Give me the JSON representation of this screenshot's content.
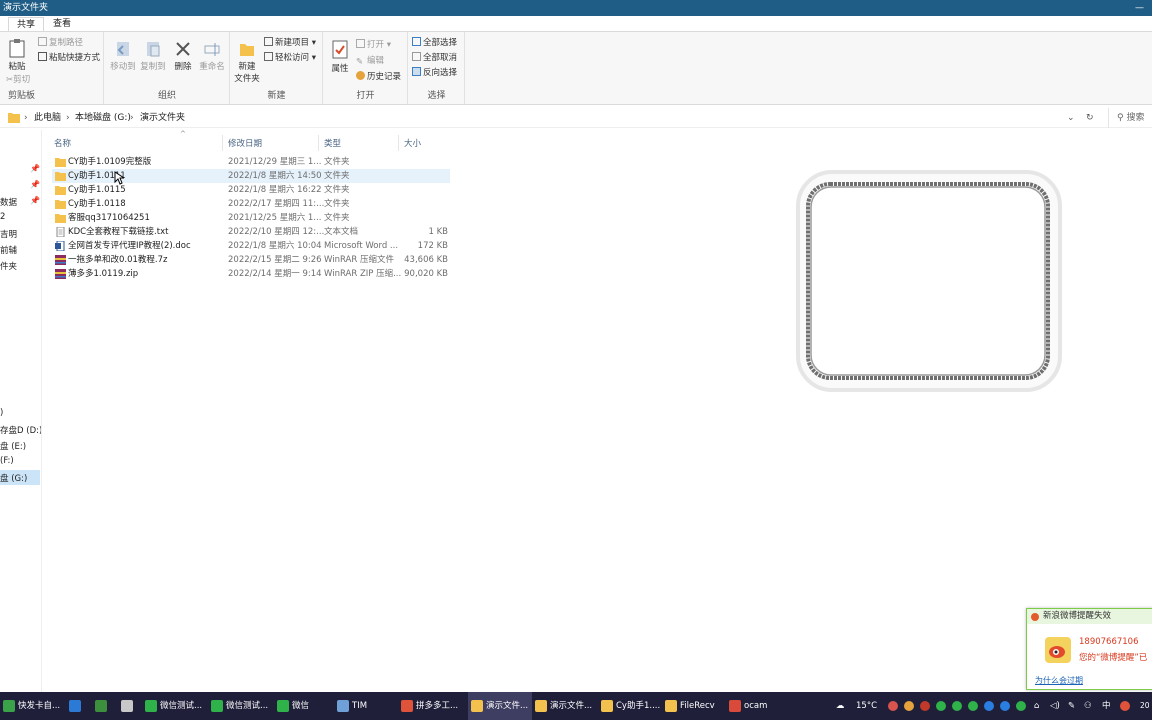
{
  "window": {
    "title": "演示文件夹",
    "minimize_glyph": "—"
  },
  "ribbon_tabs": [
    "共享",
    "查看"
  ],
  "ribbon": {
    "clipboard": {
      "paste": "粘贴",
      "copy_path": "复制路径",
      "paste_shortcut": "粘贴快捷方式",
      "cut": "剪切",
      "label": "剪贴板"
    },
    "organize": {
      "move_to": "移动到",
      "copy_to": "复制到",
      "delete": "删除",
      "rename": "重命名",
      "label": "组织"
    },
    "new": {
      "new_folder_line1": "新建",
      "new_folder_line2": "文件夹",
      "new_item": "新建项目 ▾",
      "easy_access": "轻松访问 ▾",
      "label": "新建"
    },
    "open": {
      "properties": "属性",
      "open": "打开 ▾",
      "edit": "编辑",
      "history": "历史记录",
      "label": "打开"
    },
    "select": {
      "select_all": "全部选择",
      "select_none": "全部取消",
      "invert": "反向选择",
      "label": "选择"
    }
  },
  "address": {
    "crumbs": [
      "此电脑",
      "本地磁盘 (G:)",
      "演示文件夹"
    ],
    "dropdown_glyph": "⌄",
    "refresh_glyph": "↻",
    "search_placeholder": "搜索"
  },
  "nav_pane": {
    "items": [
      "数据",
      "2",
      "吉明",
      "前辅",
      "件夹",
      ")",
      "存盘D (D:)",
      "盘 (E:)",
      "(F:)",
      "盘 (G:)"
    ],
    "selected": "盘 (G:)"
  },
  "columns": {
    "name": "名称",
    "date": "修改日期",
    "type": "类型",
    "size": "大小"
  },
  "files": [
    {
      "name": "CY助手1.0109完整版",
      "date": "2021/12/29 星期三 1...",
      "type": "文件夹",
      "size": "",
      "kind": "folder"
    },
    {
      "name": "Cy助手1.0111",
      "date": "2022/1/8 星期六 14:50",
      "type": "文件夹",
      "size": "",
      "kind": "folder"
    },
    {
      "name": "Cy助手1.0115",
      "date": "2022/1/8 星期六 16:22",
      "type": "文件夹",
      "size": "",
      "kind": "folder"
    },
    {
      "name": "Cy助手1.0118",
      "date": "2022/2/17 星期四 11:...",
      "type": "文件夹",
      "size": "",
      "kind": "folder"
    },
    {
      "name": "客服qq3171064251",
      "date": "2021/12/25 星期六 1...",
      "type": "文件夹",
      "size": "",
      "kind": "folder"
    },
    {
      "name": "KDC全套教程下载链接.txt",
      "date": "2022/2/10 星期四 12:...",
      "type": "文本文档",
      "size": "1 KB",
      "kind": "txt"
    },
    {
      "name": "全网首发专评代理IP教程(2).doc",
      "date": "2022/1/8 星期六 10:04",
      "type": "Microsoft Word ...",
      "size": "172 KB",
      "kind": "doc"
    },
    {
      "name": "一拖多单和改0.01教程.7z",
      "date": "2022/2/15 星期二 9:26",
      "type": "WinRAR 压缩文件",
      "size": "43,606 KB",
      "kind": "rar"
    },
    {
      "name": "薄多多1.0119.zip",
      "date": "2022/2/14 星期一 9:14",
      "type": "WinRAR ZIP 压缩...",
      "size": "90,020 KB",
      "kind": "rar"
    }
  ],
  "selected_row": 1,
  "toast": {
    "title": "新浪微博提醒失效",
    "phone": "18907667106",
    "message": "您的“微博提醒”已",
    "link": "为什么会过期"
  },
  "taskbar": {
    "tasks": [
      {
        "label": "快发卡自...",
        "color": "#3aa34a"
      },
      {
        "label": "",
        "color": "#2b7bd6"
      },
      {
        "label": "",
        "color": "#3c8f3c"
      },
      {
        "label": "",
        "color": "#c8c8c8"
      },
      {
        "label": "微信测试...",
        "color": "#2fb24a"
      },
      {
        "label": "微信测试...",
        "color": "#2fb24a"
      },
      {
        "label": "微信",
        "color": "#2fb24a"
      },
      {
        "label": "TIM",
        "color": "#6fa0d8"
      },
      {
        "label": "拼多多工...",
        "color": "#e0533b"
      },
      {
        "label": "演示文件...",
        "color": "#f2c14e"
      },
      {
        "label": "演示文件...",
        "color": "#f2c14e"
      },
      {
        "label": "Cy助手1....",
        "color": "#f2c14e"
      },
      {
        "label": "FileRecv",
        "color": "#f2c14e"
      },
      {
        "label": "ocam",
        "color": "#d94a3a"
      }
    ],
    "active_task": 9,
    "weather": "15°C",
    "ime": "中",
    "clock": "20"
  },
  "colors": {
    "titlebar": "#1f5d86",
    "taskbar": "#1f1f3a",
    "selection": "#cce4f7",
    "toast_border": "#7ccb49"
  }
}
